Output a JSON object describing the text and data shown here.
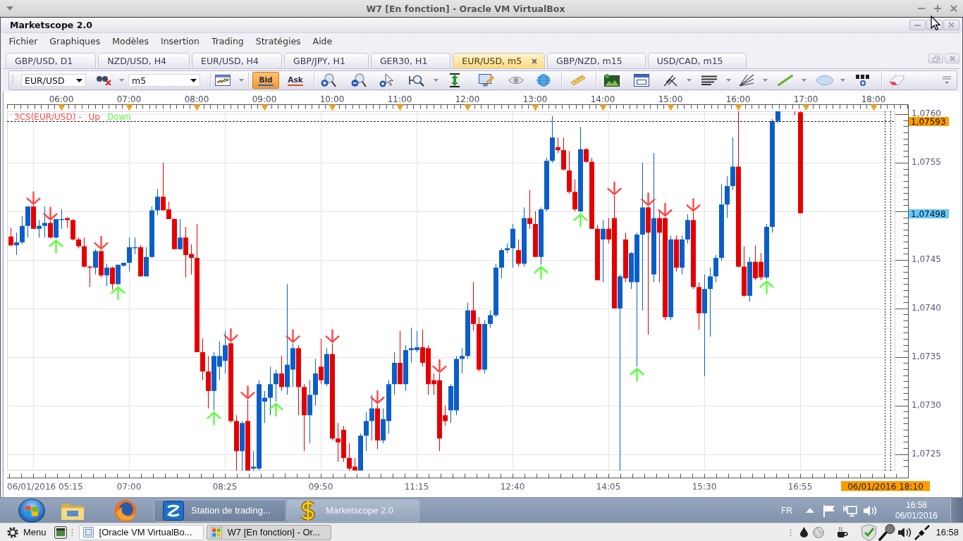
{
  "vm_window": {
    "title": "W7 [En fonction] - Oracle VM VirtualBox"
  },
  "app": {
    "title": "Marketscope 2.0",
    "menu": [
      "Fichier",
      "Graphiques",
      "Modèles",
      "Insertion",
      "Trading",
      "Stratégies",
      "Aide"
    ],
    "tabs": [
      {
        "label": "GBP/USD, D1",
        "selected": false
      },
      {
        "label": "NZD/USD, H4",
        "selected": false
      },
      {
        "label": "EUR/USD, H4",
        "selected": false
      },
      {
        "label": "GBP/JPY, H1",
        "selected": false
      },
      {
        "label": "GER30, H1",
        "selected": false
      },
      {
        "label": "EUR/USD, m5",
        "selected": true
      },
      {
        "label": "GBP/NZD, m15",
        "selected": false
      },
      {
        "label": "USD/CAD, m15",
        "selected": false
      }
    ],
    "toolbar": {
      "symbol": "EUR/USD",
      "timeframe": "m5",
      "price_sides": [
        {
          "label": "Bid",
          "selected": true,
          "color": "#1f66d6"
        },
        {
          "label": "Ask",
          "selected": false,
          "color": "#e5452b"
        }
      ]
    },
    "chart": {
      "legend": {
        "title": "3CS(EUR/USD) -",
        "entries": [
          {
            "label": "Up",
            "color": "#ff4646"
          },
          {
            "label": "Down",
            "color": "#5cff3c"
          }
        ]
      },
      "time_ruler": [
        "06:00",
        "07:00",
        "08:00",
        "09:00",
        "10:00",
        "11:00",
        "12:00",
        "13:00",
        "14:00",
        "15:00",
        "16:00",
        "17:00",
        "18:00"
      ],
      "price_labels": [
        "1,0760",
        "1,0755",
        "1,0745",
        "1,0740",
        "1,0735",
        "1,0730",
        "1,0725"
      ],
      "time_labels": [
        "06/01/2016 05:15",
        "07:00",
        "08:25",
        "09:50",
        "11:15",
        "12:40",
        "14:05",
        "15:30",
        "16:55"
      ],
      "price_tags": [
        {
          "label": "1,07593",
          "kind": "line",
          "color": "#ff9c00"
        },
        {
          "label": "1,07498",
          "kind": "tag",
          "color": "#66c8ff"
        }
      ],
      "time_tag": "06/01/2016 18:10"
    }
  },
  "win_taskbar": {
    "tasks": [
      {
        "label": "Station de trading...",
        "kind": "station",
        "selected": false
      },
      {
        "label": "Marketscope 2.0",
        "kind": "dollar",
        "selected": true
      }
    ],
    "language": "FR",
    "time": "16:58",
    "date": "06/01/2016"
  },
  "panel": {
    "menu": "Menu",
    "tasks": [
      {
        "label": "[Oracle VM VirtualBo...",
        "kind": "vbox",
        "selected": false
      },
      {
        "label": "W7 [En fonction] - Or...",
        "kind": "vm",
        "selected": true
      }
    ],
    "time": "16:58"
  }
}
